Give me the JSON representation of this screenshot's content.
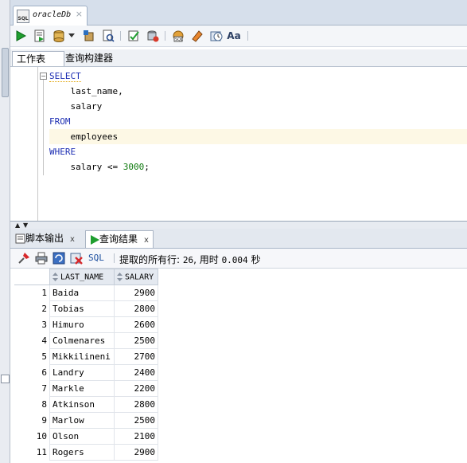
{
  "document_tab": {
    "title": "oracleDb",
    "icon": "sql-file-icon",
    "icon_text": "SQL",
    "close": "×"
  },
  "toolbar": {
    "buttons": [
      "run-statement-icon",
      "run-script-icon",
      "commit-icon",
      "rollback-icon",
      "explain-plan-icon",
      "autotrace-icon",
      "clear-icon",
      "sql-tuning-icon",
      "eraser-icon",
      "history-icon",
      "format-icon"
    ]
  },
  "subtabs": {
    "worksheet": "工作表",
    "query_builder": "查询构建器"
  },
  "editor": {
    "lines": [
      {
        "kw": "SELECT"
      },
      {
        "text": "    last_name,"
      },
      {
        "text": "    salary"
      },
      {
        "kw": "FROM"
      },
      {
        "text": "    employees"
      },
      {
        "kw": "WHERE"
      },
      {
        "text": "    salary <= ",
        "num": "3000",
        "after": ";"
      }
    ]
  },
  "bottom_tabs": {
    "script_output": "脚本输出",
    "query_result": "查询结果",
    "close": "x"
  },
  "result_toolbar": {
    "sql_label": "SQL",
    "fetch_label": "提取的所有行: ",
    "row_count": "26",
    "time_label": ", 用时 ",
    "time_value": "0.004",
    "seconds_label": " 秒"
  },
  "grid": {
    "columns": [
      "LAST_NAME",
      "SALARY"
    ],
    "rows": [
      [
        "1",
        "Baida",
        "2900"
      ],
      [
        "2",
        "Tobias",
        "2800"
      ],
      [
        "3",
        "Himuro",
        "2600"
      ],
      [
        "4",
        "Colmenares",
        "2500"
      ],
      [
        "5",
        "Mikkilineni",
        "2700"
      ],
      [
        "6",
        "Landry",
        "2400"
      ],
      [
        "7",
        "Markle",
        "2200"
      ],
      [
        "8",
        "Atkinson",
        "2800"
      ],
      [
        "9",
        "Marlow",
        "2500"
      ],
      [
        "10",
        "Olson",
        "2100"
      ],
      [
        "11",
        "Rogers",
        "2900"
      ]
    ]
  },
  "colors": {
    "keyword": "#1e2fb3",
    "number": "#0f7a0f",
    "current_line": "#fdf8e5"
  }
}
